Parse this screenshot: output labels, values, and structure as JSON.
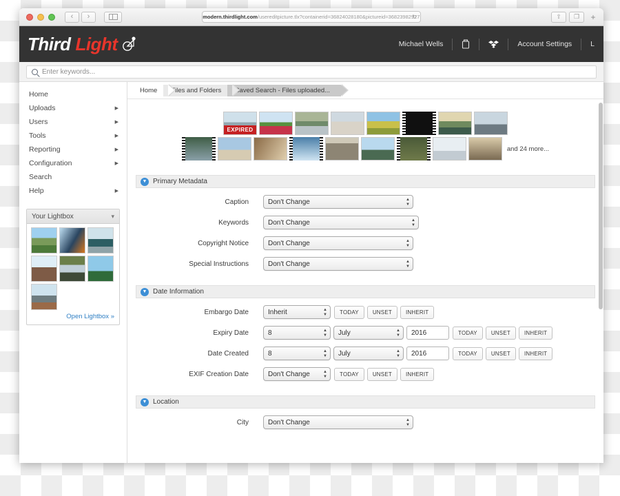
{
  "browser": {
    "url_lock": "lock-icon",
    "url_host": "modern.thirdlight.com",
    "url_path": "/usereditpicture.tlx?containerid=36824028180&pictureid=36823982927",
    "reload": "↻",
    "back": "‹",
    "forward": "›",
    "sidebar_toggle": "sidebar-icon",
    "share": "⇧",
    "tabs": "❐",
    "newtab": "+"
  },
  "header": {
    "logo_first": "Third",
    "logo_second": "Light",
    "logo_mark": "aperture-icon",
    "user": "Michael Wells",
    "trash_icon": "🗑",
    "dropbox_icon": "dropbox-icon",
    "account_settings": "Account Settings",
    "logout": "L"
  },
  "search": {
    "placeholder": "Enter keywords...",
    "icon": "search-icon",
    "value": ""
  },
  "sidebar": {
    "items": [
      {
        "label": "Home",
        "arrow": ""
      },
      {
        "label": "Uploads",
        "arrow": "▶"
      },
      {
        "label": "Users",
        "arrow": "▶"
      },
      {
        "label": "Tools",
        "arrow": "▶"
      },
      {
        "label": "Reporting",
        "arrow": "▶"
      },
      {
        "label": "Configuration",
        "arrow": "▶"
      },
      {
        "label": "Search",
        "arrow": ""
      },
      {
        "label": "Help",
        "arrow": "▶"
      }
    ],
    "lightbox": {
      "title": "Your Lightbox",
      "chevron": "⌄",
      "thumb_count": 7,
      "open_link": "Open Lightbox »"
    }
  },
  "breadcrumb": [
    {
      "label": "Home"
    },
    {
      "label": "Files and Folders"
    },
    {
      "label": "Saved Search - Files uploaded..."
    }
  ],
  "thumbstrip": {
    "badge": "EXPIRED",
    "more_text": "and 24 more...",
    "row1_count": 8,
    "row2_count": 9
  },
  "sections": [
    {
      "title": "Primary Metadata",
      "rows": [
        {
          "label": "Caption",
          "value": "Don't Change",
          "width": "wide"
        },
        {
          "label": "Keywords",
          "value": "Don't Change",
          "width": "wide2"
        },
        {
          "label": "Copyright Notice",
          "value": "Don't Change",
          "width": "wide"
        },
        {
          "label": "Special Instructions",
          "value": "Don't Change",
          "width": "wide"
        }
      ]
    }
  ],
  "date_section": {
    "title": "Date Information",
    "buttons": {
      "today": "TODAY",
      "unset": "UNSET",
      "inherit": "INHERIT"
    },
    "rows": [
      {
        "label": "Embargo Date",
        "mode": "single",
        "value": "Inherit"
      },
      {
        "label": "Expiry Date",
        "mode": "full",
        "day": "8",
        "month": "July",
        "year": "2016"
      },
      {
        "label": "Date Created",
        "mode": "full",
        "day": "8",
        "month": "July",
        "year": "2016"
      },
      {
        "label": "EXIF Creation Date",
        "mode": "single",
        "value": "Don't Change"
      }
    ]
  },
  "location_section": {
    "title": "Location",
    "rows": [
      {
        "label": "City",
        "value": "Don't Change"
      }
    ]
  }
}
